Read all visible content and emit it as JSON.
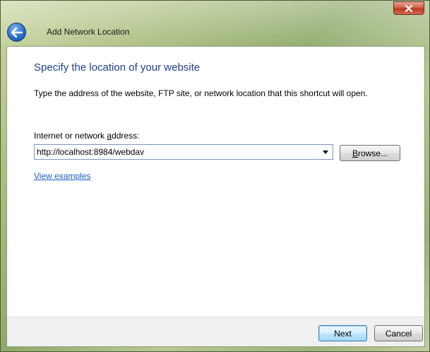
{
  "window": {
    "title": "Add Network Location",
    "close_icon": "close-icon",
    "back_icon": "back-arrow-icon"
  },
  "main": {
    "heading": "Specify the location of your website",
    "instruction": "Type the address of the website, FTP site, or network location that this shortcut will open.",
    "address_label_prefix": "Internet or network ",
    "address_label_access": "a",
    "address_label_suffix": "ddress:",
    "address_value": "http://localhost:8984/webdav",
    "browse_label_access": "B",
    "browse_label_rest": "rowse...",
    "view_examples": "View examples"
  },
  "footer": {
    "next_label": "Next",
    "cancel_label": "Cancel"
  },
  "colors": {
    "heading": "#1e3f8a",
    "link": "#1c5cc7",
    "close_red": "#c8442a"
  }
}
